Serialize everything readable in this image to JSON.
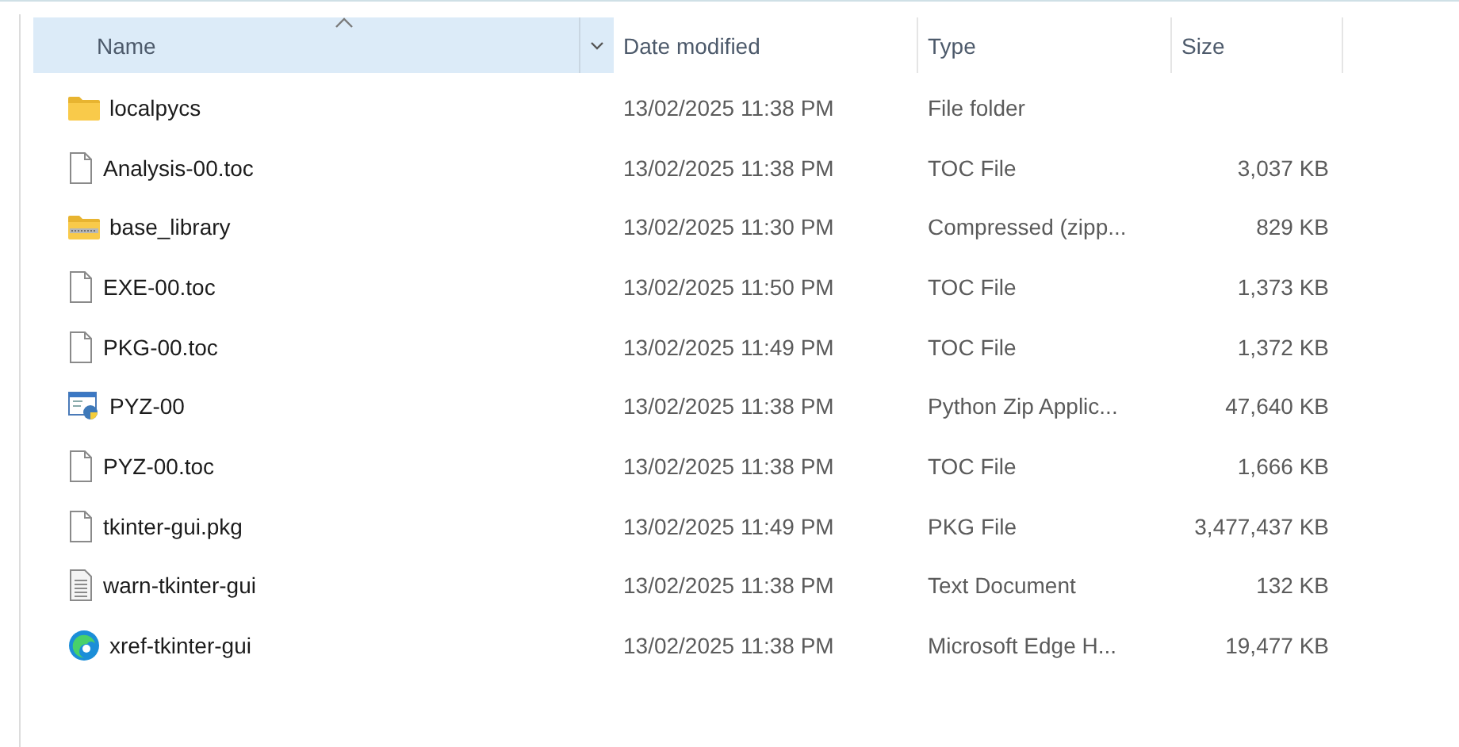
{
  "columns": [
    {
      "label": "Name",
      "sorted": true,
      "hovered": true
    },
    {
      "label": "Date modified",
      "sorted": false,
      "hovered": false
    },
    {
      "label": "Type",
      "sorted": false,
      "hovered": false
    },
    {
      "label": "Size",
      "sorted": false,
      "hovered": false
    }
  ],
  "rows": [
    {
      "kind": "folder",
      "name": "localpycs",
      "date": "13/02/2025 11:38 PM",
      "type": "File folder",
      "size": ""
    },
    {
      "kind": "file",
      "name": "Analysis-00.toc",
      "date": "13/02/2025 11:38 PM",
      "type": "TOC File",
      "size": "3,037 KB"
    },
    {
      "kind": "zip",
      "name": "base_library",
      "date": "13/02/2025 11:30 PM",
      "type": "Compressed (zipp...",
      "size": "829 KB"
    },
    {
      "kind": "file",
      "name": "EXE-00.toc",
      "date": "13/02/2025 11:50 PM",
      "type": "TOC File",
      "size": "1,373 KB"
    },
    {
      "kind": "file",
      "name": "PKG-00.toc",
      "date": "13/02/2025 11:49 PM",
      "type": "TOC File",
      "size": "1,372 KB"
    },
    {
      "kind": "app",
      "name": "PYZ-00",
      "date": "13/02/2025 11:38 PM",
      "type": "Python Zip Applic...",
      "size": "47,640 KB"
    },
    {
      "kind": "file",
      "name": "PYZ-00.toc",
      "date": "13/02/2025 11:38 PM",
      "type": "TOC File",
      "size": "1,666 KB"
    },
    {
      "kind": "file",
      "name": "tkinter-gui.pkg",
      "date": "13/02/2025 11:49 PM",
      "type": "PKG File",
      "size": "3,477,437 KB"
    },
    {
      "kind": "text",
      "name": "warn-tkinter-gui",
      "date": "13/02/2025 11:38 PM",
      "type": "Text Document",
      "size": "132 KB"
    },
    {
      "kind": "browser",
      "name": "xref-tkinter-gui",
      "date": "13/02/2025 11:38 PM",
      "type": "Microsoft Edge H...",
      "size": "19,477 KB"
    }
  ]
}
